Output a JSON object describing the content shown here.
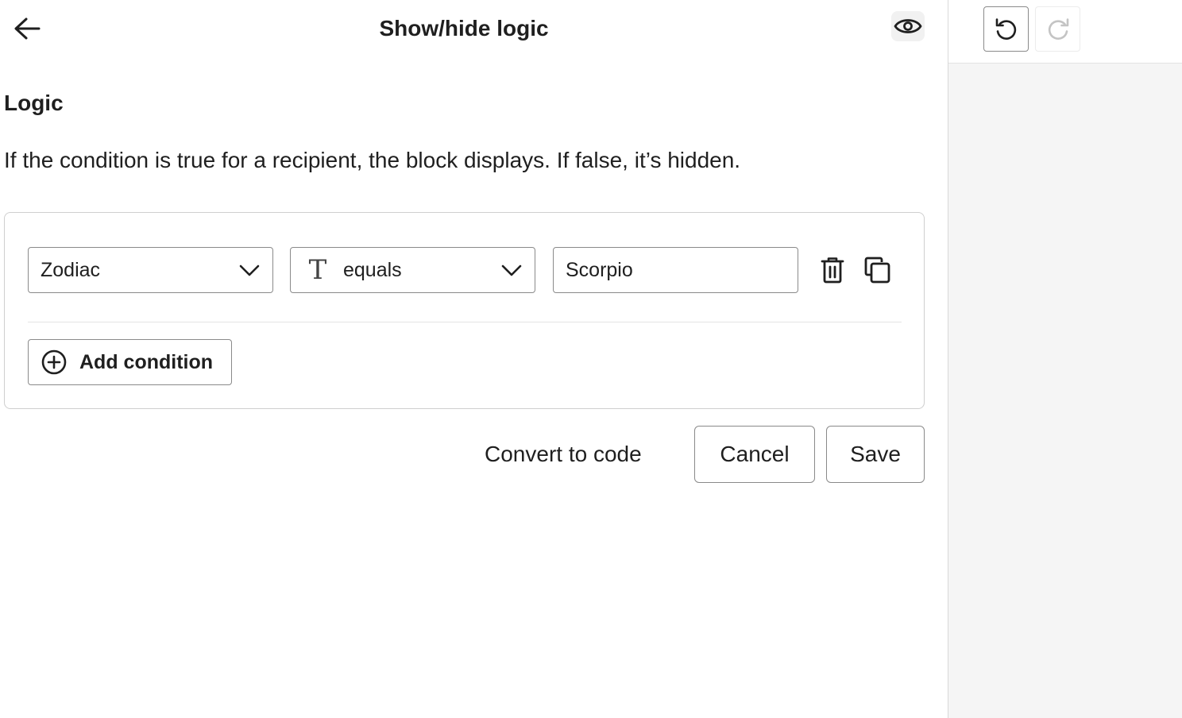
{
  "header": {
    "title": "Show/hide logic",
    "back_icon": "arrow-left-icon",
    "preview_icon": "eye-icon"
  },
  "logic": {
    "title": "Logic",
    "description": "If the condition is true for a recipient, the block displays. If false, it’s hidden."
  },
  "condition": {
    "field_value": "Zodiac",
    "operator_type_glyph": "T",
    "operator_value": "equals",
    "value": "Scorpio",
    "delete_icon": "trash-icon",
    "duplicate_icon": "copy-icon"
  },
  "add_condition_label": "Add condition",
  "actions": {
    "convert_label": "Convert to code",
    "cancel_label": "Cancel",
    "save_label": "Save"
  },
  "toolbar": {
    "undo_icon": "undo-icon",
    "redo_icon": "redo-icon",
    "redo_enabled": false
  },
  "colors": {
    "border": "#8a8a8a",
    "text": "#1f1f1f",
    "canvas": "#f5f5f5"
  }
}
